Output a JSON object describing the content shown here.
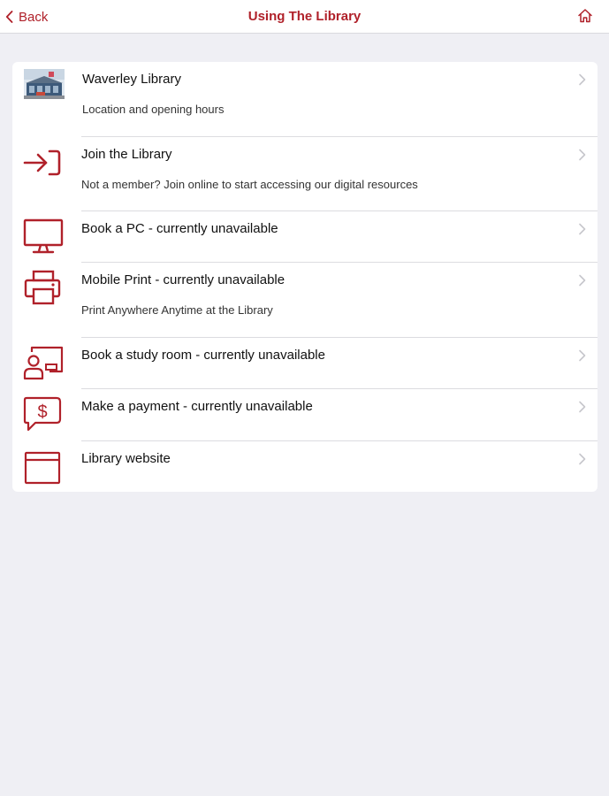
{
  "navbar": {
    "back_label": "Back",
    "title": "Using The Library",
    "accent_color": "#b0212a"
  },
  "menu": {
    "items": [
      {
        "title": "Waverley Library",
        "subtitle": "Location and opening hours",
        "icon": "library-photo"
      },
      {
        "title": "Join the Library",
        "subtitle": "Not a member? Join online to start accessing our digital resources",
        "icon": "sign-in-icon"
      },
      {
        "title": "Book a PC - currently unavailable",
        "subtitle": "",
        "icon": "monitor-icon"
      },
      {
        "title": "Mobile Print - currently unavailable",
        "subtitle": "Print Anywhere Anytime at the Library",
        "icon": "printer-icon"
      },
      {
        "title": "Book a study room - currently unavailable",
        "subtitle": "",
        "icon": "study-room-icon"
      },
      {
        "title": "Make a payment - currently unavailable",
        "subtitle": "",
        "icon": "payment-icon"
      },
      {
        "title": "Library website",
        "subtitle": "",
        "icon": "browser-window-icon"
      }
    ]
  }
}
